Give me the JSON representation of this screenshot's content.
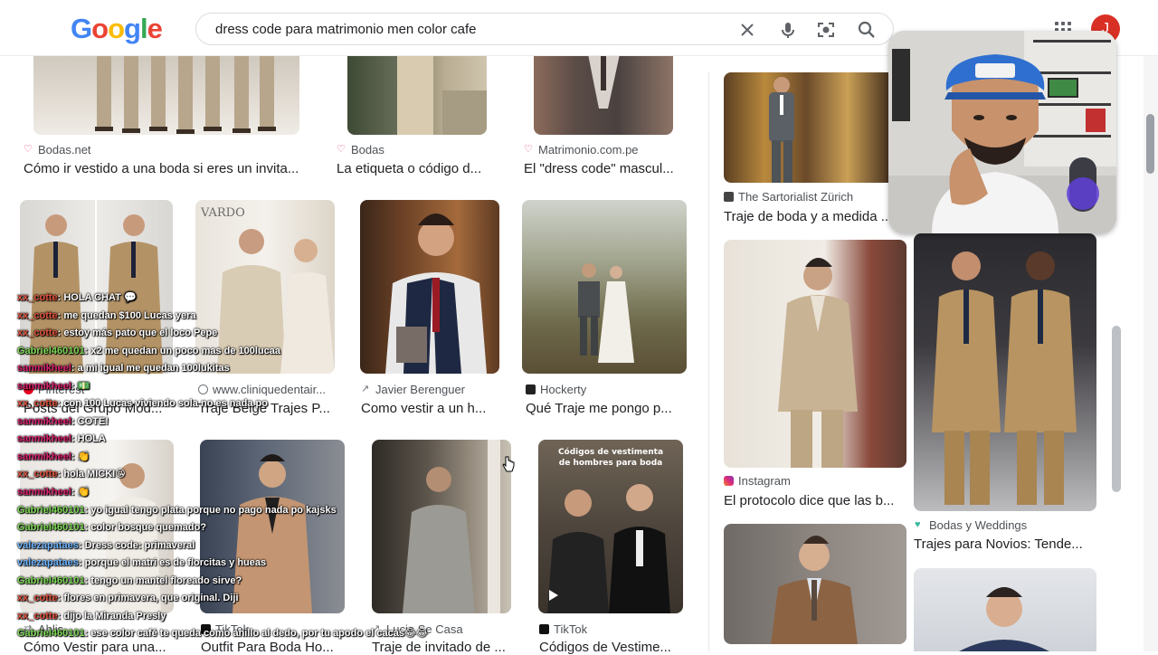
{
  "search": {
    "query": "dress code para matrimonio men color cafe"
  },
  "logo": {
    "letters": [
      "G",
      "o",
      "o",
      "g",
      "l",
      "e"
    ],
    "colors": [
      "#4285F4",
      "#EA4335",
      "#FBBC05",
      "#4285F4",
      "#34A853",
      "#EA4335"
    ]
  },
  "account": {
    "initial": "J"
  },
  "results": [
    {
      "source": "Bodas.net",
      "icon": "heart-icon",
      "title": "Cómo ir vestido a una boda si eres un invita..."
    },
    {
      "source": "Bodas",
      "icon": "heart-icon",
      "title": "La etiqueta o código d..."
    },
    {
      "source": "Matrimonio.com.pe",
      "icon": "heart-icon",
      "title": "El \"dress code\" mascul..."
    },
    {
      "source": "The Sartorialist Zürich",
      "icon": "site-icon",
      "title": "Traje de boda y a medida ..."
    },
    {
      "source": "Pinterest",
      "icon": "pinterest-icon",
      "title": "Posts del Grupo Mod..."
    },
    {
      "source": "www.cliniquedentair...",
      "icon": "globe-icon",
      "title": "Traje Beige Trajes P..."
    },
    {
      "source": "Javier Berenguer",
      "icon": "site-icon",
      "title": "Como vestir a un h..."
    },
    {
      "source": "Hockerty",
      "icon": "site-icon",
      "title": "Qué Traje me pongo p..."
    },
    {
      "source": "Instagram",
      "icon": "instagram-icon",
      "title": "El protocolo dice que las b..."
    },
    {
      "source": "Bodas y Weddings",
      "icon": "heart-icon",
      "title": "Trajes para Novios: Tende..."
    },
    {
      "source": "Ahlis",
      "icon": "site-icon",
      "title": "Cómo Vestir para una..."
    },
    {
      "source": "TikTok",
      "icon": "tiktok-icon",
      "title": "Outfit Para Boda Ho..."
    },
    {
      "source": "Lucia Se Casa",
      "icon": "site-icon",
      "title": "Traje de invitado de ..."
    },
    {
      "source": "TikTok",
      "icon": "tiktok-icon",
      "title": "Códigos de Vestime..."
    }
  ],
  "video_overlay_text": "Códigos de vestimenta de hombres para boda",
  "thumb_labels": {
    "vardo": "VARDO"
  },
  "chat": [
    {
      "user": "xx_cotte",
      "color": "#e0523c",
      "text": ": HOLA CHAT 💬"
    },
    {
      "user": "xx_cotte",
      "color": "#e0523c",
      "text": ": me quedan $100 Lucas yera"
    },
    {
      "user": "xx_cotte",
      "color": "#e0523c",
      "text": ": estoy más pato que el loco Pepe"
    },
    {
      "user": "Gabriel460101",
      "color": "#7ed957",
      "text": ": x2 me quedan un poco mas de 100lucaa"
    },
    {
      "user": "sanmikheel",
      "color": "#d9206e",
      "text": ": a mi igual me quedan 100lukitas"
    },
    {
      "user": "sanmikheel",
      "color": "#d9206e",
      "text": ": 💵"
    },
    {
      "user": "xx_cotte",
      "color": "#e0523c",
      "text": ": con 100 Lucas viviendo sola no es nada po"
    },
    {
      "user": "sanmikheel",
      "color": "#d9206e",
      "text": ": COTE!"
    },
    {
      "user": "sanmikheel",
      "color": "#d9206e",
      "text": ": HOLA"
    },
    {
      "user": "sanmikheel",
      "color": "#d9206e",
      "text": ": 👏"
    },
    {
      "user": "xx_cotte",
      "color": "#e0523c",
      "text": ": hola MICKI😘"
    },
    {
      "user": "sanmikheel",
      "color": "#d9206e",
      "text": ": 👏"
    },
    {
      "user": "Gabriel460101",
      "color": "#7ed957",
      "text": ": yo igual tengo plata porque no pago nada po kajsks"
    },
    {
      "user": "Gabriel460101",
      "color": "#7ed957",
      "text": ": color bosque quemado?"
    },
    {
      "user": "valezapataes",
      "color": "#6fb6ff",
      "text": ": Dress code: primaveral"
    },
    {
      "user": "valezapataes",
      "color": "#6fb6ff",
      "text": ": porque el matri es de florcitas y hueas"
    },
    {
      "user": "Gabriel460101",
      "color": "#7ed957",
      "text": ": tengo un mantel floreado sirve?"
    },
    {
      "user": "xx_cotte",
      "color": "#e0523c",
      "text": ": flores en primavera, que original. Diji"
    },
    {
      "user": "xx_cotte",
      "color": "#e0523c",
      "text": ": dijo la Miranda Presly"
    },
    {
      "user": "Gabriel460101",
      "color": "#7ed957",
      "text": ": ese color café te queda como anillo al dedo, por tu apodo el cacas😂😂"
    }
  ]
}
